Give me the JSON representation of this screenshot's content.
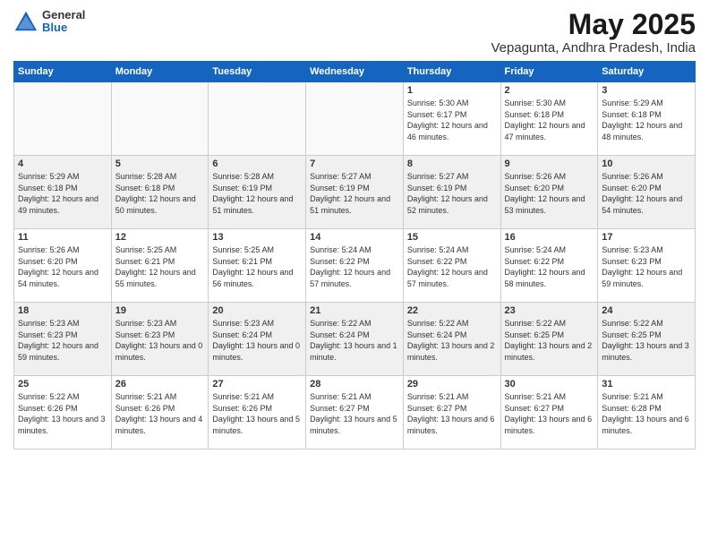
{
  "logo": {
    "general": "General",
    "blue": "Blue"
  },
  "header": {
    "title": "May 2025",
    "subtitle": "Vepagunta, Andhra Pradesh, India"
  },
  "days_of_week": [
    "Sunday",
    "Monday",
    "Tuesday",
    "Wednesday",
    "Thursday",
    "Friday",
    "Saturday"
  ],
  "weeks": [
    {
      "shaded": false,
      "days": [
        {
          "num": "",
          "empty": true
        },
        {
          "num": "",
          "empty": true
        },
        {
          "num": "",
          "empty": true
        },
        {
          "num": "",
          "empty": true
        },
        {
          "num": "1",
          "sunrise": "5:30 AM",
          "sunset": "6:17 PM",
          "daylight": "12 hours and 46 minutes."
        },
        {
          "num": "2",
          "sunrise": "5:30 AM",
          "sunset": "6:18 PM",
          "daylight": "12 hours and 47 minutes."
        },
        {
          "num": "3",
          "sunrise": "5:29 AM",
          "sunset": "6:18 PM",
          "daylight": "12 hours and 48 minutes."
        }
      ]
    },
    {
      "shaded": true,
      "days": [
        {
          "num": "4",
          "sunrise": "5:29 AM",
          "sunset": "6:18 PM",
          "daylight": "12 hours and 49 minutes."
        },
        {
          "num": "5",
          "sunrise": "5:28 AM",
          "sunset": "6:18 PM",
          "daylight": "12 hours and 50 minutes."
        },
        {
          "num": "6",
          "sunrise": "5:28 AM",
          "sunset": "6:19 PM",
          "daylight": "12 hours and 51 minutes."
        },
        {
          "num": "7",
          "sunrise": "5:27 AM",
          "sunset": "6:19 PM",
          "daylight": "12 hours and 51 minutes."
        },
        {
          "num": "8",
          "sunrise": "5:27 AM",
          "sunset": "6:19 PM",
          "daylight": "12 hours and 52 minutes."
        },
        {
          "num": "9",
          "sunrise": "5:26 AM",
          "sunset": "6:20 PM",
          "daylight": "12 hours and 53 minutes."
        },
        {
          "num": "10",
          "sunrise": "5:26 AM",
          "sunset": "6:20 PM",
          "daylight": "12 hours and 54 minutes."
        }
      ]
    },
    {
      "shaded": false,
      "days": [
        {
          "num": "11",
          "sunrise": "5:26 AM",
          "sunset": "6:20 PM",
          "daylight": "12 hours and 54 minutes."
        },
        {
          "num": "12",
          "sunrise": "5:25 AM",
          "sunset": "6:21 PM",
          "daylight": "12 hours and 55 minutes."
        },
        {
          "num": "13",
          "sunrise": "5:25 AM",
          "sunset": "6:21 PM",
          "daylight": "12 hours and 56 minutes."
        },
        {
          "num": "14",
          "sunrise": "5:24 AM",
          "sunset": "6:22 PM",
          "daylight": "12 hours and 57 minutes."
        },
        {
          "num": "15",
          "sunrise": "5:24 AM",
          "sunset": "6:22 PM",
          "daylight": "12 hours and 57 minutes."
        },
        {
          "num": "16",
          "sunrise": "5:24 AM",
          "sunset": "6:22 PM",
          "daylight": "12 hours and 58 minutes."
        },
        {
          "num": "17",
          "sunrise": "5:23 AM",
          "sunset": "6:23 PM",
          "daylight": "12 hours and 59 minutes."
        }
      ]
    },
    {
      "shaded": true,
      "days": [
        {
          "num": "18",
          "sunrise": "5:23 AM",
          "sunset": "6:23 PM",
          "daylight": "12 hours and 59 minutes."
        },
        {
          "num": "19",
          "sunrise": "5:23 AM",
          "sunset": "6:23 PM",
          "daylight": "13 hours and 0 minutes."
        },
        {
          "num": "20",
          "sunrise": "5:23 AM",
          "sunset": "6:24 PM",
          "daylight": "13 hours and 0 minutes."
        },
        {
          "num": "21",
          "sunrise": "5:22 AM",
          "sunset": "6:24 PM",
          "daylight": "13 hours and 1 minute."
        },
        {
          "num": "22",
          "sunrise": "5:22 AM",
          "sunset": "6:24 PM",
          "daylight": "13 hours and 2 minutes."
        },
        {
          "num": "23",
          "sunrise": "5:22 AM",
          "sunset": "6:25 PM",
          "daylight": "13 hours and 2 minutes."
        },
        {
          "num": "24",
          "sunrise": "5:22 AM",
          "sunset": "6:25 PM",
          "daylight": "13 hours and 3 minutes."
        }
      ]
    },
    {
      "shaded": false,
      "days": [
        {
          "num": "25",
          "sunrise": "5:22 AM",
          "sunset": "6:26 PM",
          "daylight": "13 hours and 3 minutes."
        },
        {
          "num": "26",
          "sunrise": "5:21 AM",
          "sunset": "6:26 PM",
          "daylight": "13 hours and 4 minutes."
        },
        {
          "num": "27",
          "sunrise": "5:21 AM",
          "sunset": "6:26 PM",
          "daylight": "13 hours and 5 minutes."
        },
        {
          "num": "28",
          "sunrise": "5:21 AM",
          "sunset": "6:27 PM",
          "daylight": "13 hours and 5 minutes."
        },
        {
          "num": "29",
          "sunrise": "5:21 AM",
          "sunset": "6:27 PM",
          "daylight": "13 hours and 6 minutes."
        },
        {
          "num": "30",
          "sunrise": "5:21 AM",
          "sunset": "6:27 PM",
          "daylight": "13 hours and 6 minutes."
        },
        {
          "num": "31",
          "sunrise": "5:21 AM",
          "sunset": "6:28 PM",
          "daylight": "13 hours and 6 minutes."
        }
      ]
    }
  ]
}
